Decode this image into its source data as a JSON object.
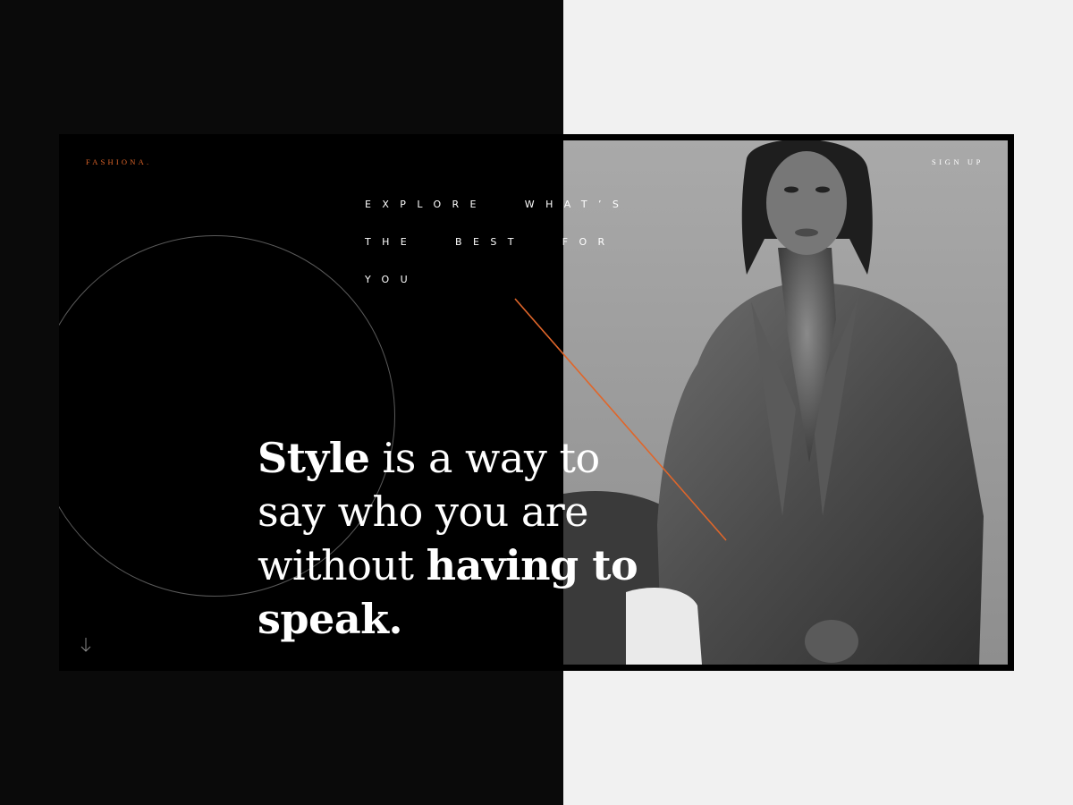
{
  "brand": {
    "logo": "FASHIONA."
  },
  "nav": {
    "signup_label": "SIGN UP"
  },
  "hero": {
    "tagline_lines": [
      "EXPLORE WHAT’S",
      "THE BEST FOR",
      "YOU"
    ],
    "headline": {
      "p1_bold": "Style",
      "p2": " is a way to say who you are without ",
      "p3_bold": "having to speak."
    }
  },
  "icons": {
    "scroll": "arrow-down-icon"
  },
  "colors": {
    "accent": "#e0662a",
    "dark": "#000000",
    "light": "#f1f1f1"
  }
}
